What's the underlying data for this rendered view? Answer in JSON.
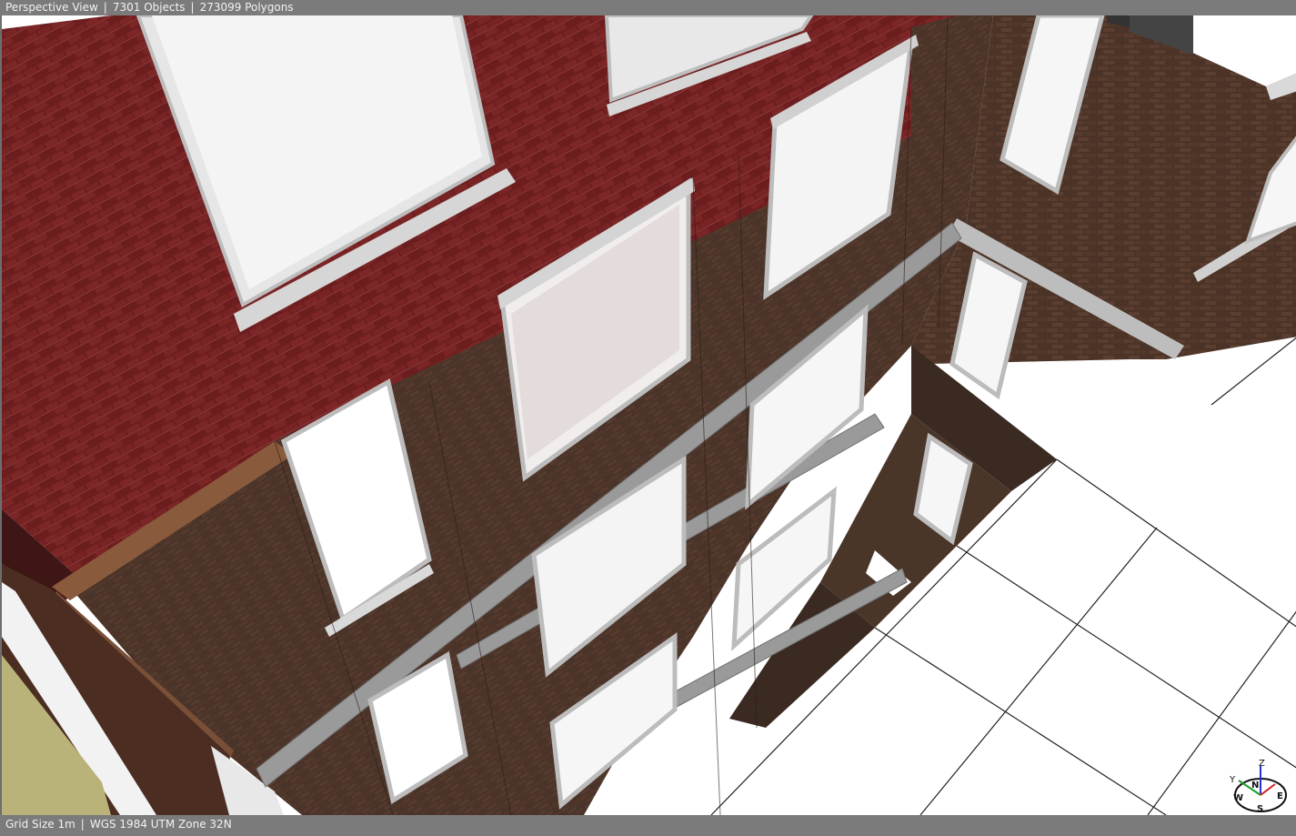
{
  "window": {
    "view_name": "Perspective View",
    "objects": "7301 Objects",
    "polygons": "273099 Polygons"
  },
  "status": {
    "grid_size": "Grid Size 1m",
    "coordinate_system": "WGS 1984 UTM Zone 32N"
  },
  "compass": {
    "labels": {
      "north": "N",
      "east": "E",
      "south": "S",
      "west": "W"
    },
    "axis_labels": {
      "y": "Y",
      "z": "Z"
    },
    "icon": "navigation-compass-icon"
  },
  "colors": {
    "status_bar": "#7b7b7b",
    "status_text": "#f2f2f2",
    "brick_red": "#6e1f1f",
    "brick_brown": "#4a3328",
    "window_glass": "#f3f3f3",
    "window_frame": "#c7c7c7",
    "ground_plane": "#ffffff",
    "axis_x": "#d22020",
    "axis_y": "#1f9d2b",
    "axis_z": "#2430d8"
  }
}
